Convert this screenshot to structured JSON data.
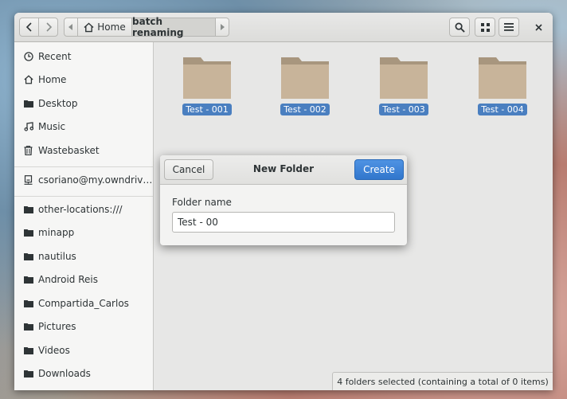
{
  "header": {
    "path_home": "Home",
    "path_current": "batch renaming"
  },
  "sidebar": {
    "items": [
      {
        "label": "Recent",
        "icon": "clock-icon"
      },
      {
        "label": "Home",
        "icon": "home-icon"
      },
      {
        "label": "Desktop",
        "icon": "folder-icon"
      },
      {
        "label": "Music",
        "icon": "music-icon"
      },
      {
        "label": "Wastebasket",
        "icon": "trash-icon"
      },
      {
        "label": "csoriano@my.owndriv…",
        "icon": "network-drive-icon"
      },
      {
        "label": "other-locations:///",
        "icon": "folder-icon"
      },
      {
        "label": "minapp",
        "icon": "folder-icon"
      },
      {
        "label": "nautilus",
        "icon": "folder-icon"
      },
      {
        "label": "Android Reis",
        "icon": "folder-icon"
      },
      {
        "label": "Compartida_Carlos",
        "icon": "folder-icon"
      },
      {
        "label": "Pictures",
        "icon": "folder-icon"
      },
      {
        "label": "Videos",
        "icon": "folder-icon"
      },
      {
        "label": "Downloads",
        "icon": "folder-icon"
      }
    ]
  },
  "files": [
    {
      "name": "Test - 001"
    },
    {
      "name": "Test - 002"
    },
    {
      "name": "Test - 003"
    },
    {
      "name": "Test - 004"
    }
  ],
  "status": "4 folders selected  (containing a total of 0 items)",
  "dialog": {
    "cancel": "Cancel",
    "title": "New Folder",
    "create": "Create",
    "field_label": "Folder name",
    "field_value": "Test - 00"
  },
  "colors": {
    "accent": "#3d82d8",
    "selection": "#4a7fc0",
    "folder": "#c8b49a"
  }
}
